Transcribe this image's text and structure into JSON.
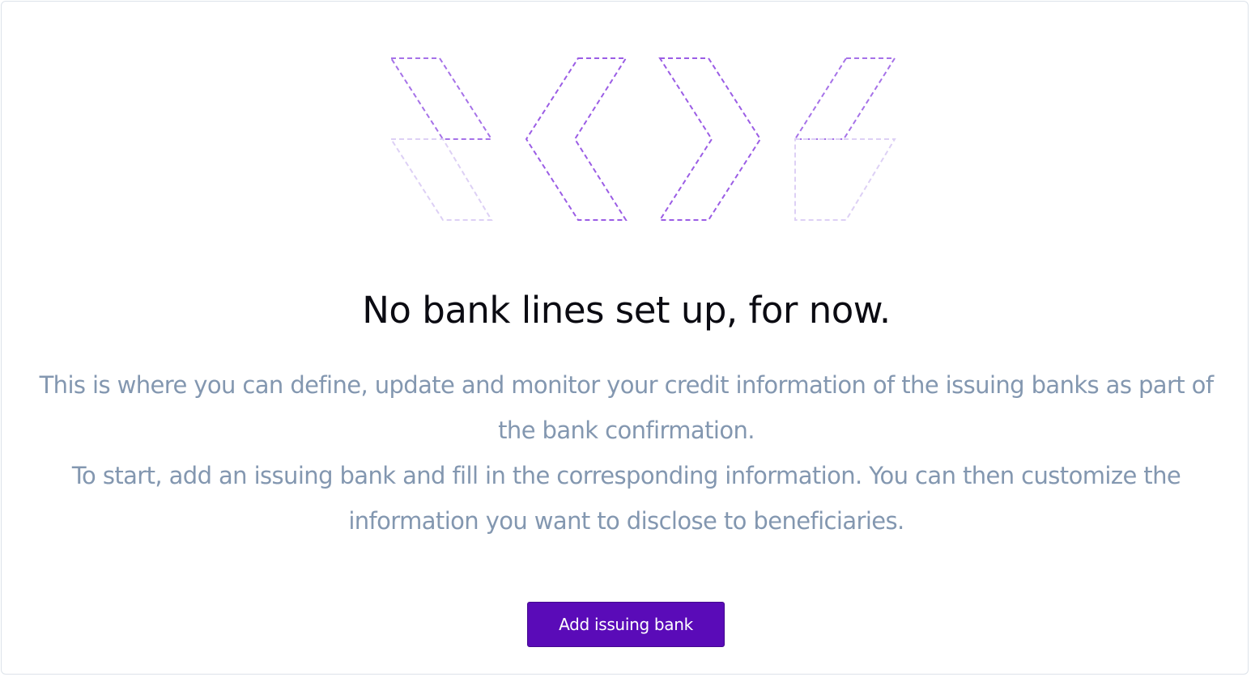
{
  "empty_state": {
    "illustration_icon": "dashed-chevrons-icon",
    "title": "No bank lines set up, for now.",
    "description_line_1": "This is where you can define, update and monitor your credit information of the issuing banks as part of the bank confirmation.",
    "description_line_2": "To start, add an issuing bank and fill in the corresponding information. You can then customize the information you want to disclose to beneficiaries.",
    "add_button_label": "Add issuing bank"
  },
  "colors": {
    "accent": "#5a0bb8",
    "illustration_stroke": "#9b5de5",
    "illustration_faded": "#ddd0f5",
    "title": "#0b0b12",
    "description": "#8397b0",
    "border": "#dde3ea"
  }
}
